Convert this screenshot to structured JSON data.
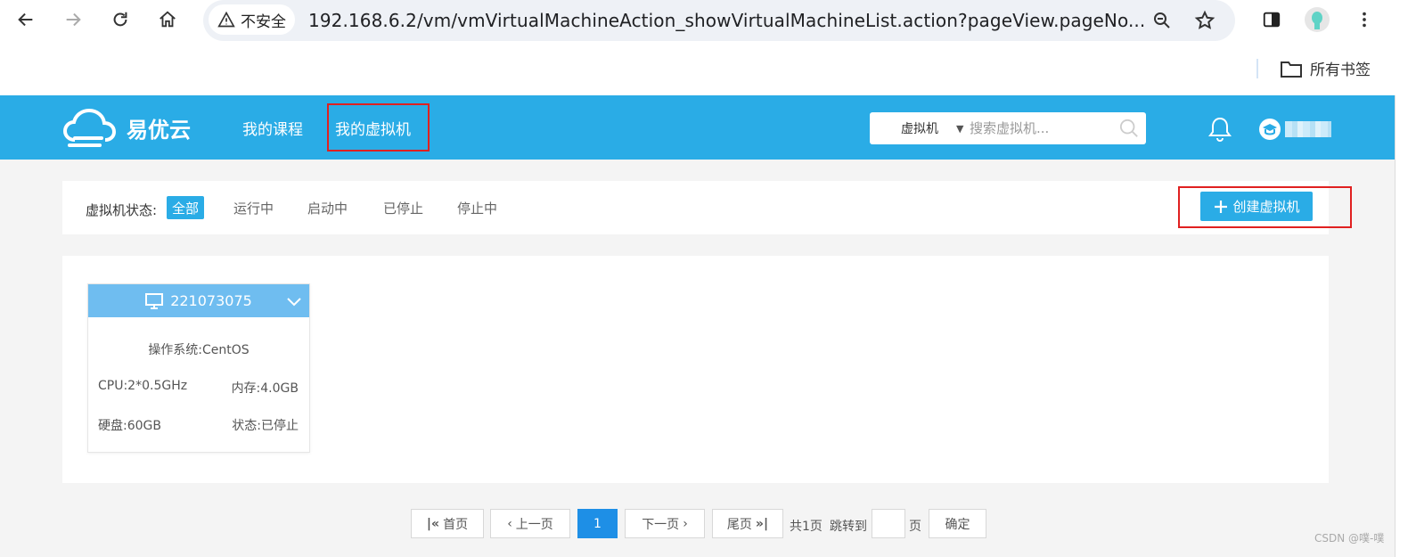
{
  "browser": {
    "security_label": "不安全",
    "url": "192.168.6.2/vm/vmVirtualMachineAction_showVirtualMachineList.action?pageView.pageNo...",
    "bookmark_folder": "所有书签"
  },
  "header": {
    "logo_text": "易优云",
    "nav": [
      {
        "label": "我的课程"
      },
      {
        "label": "我的虚拟机"
      }
    ],
    "search": {
      "type": "虚拟机",
      "placeholder": "搜索虚拟机..."
    }
  },
  "filter": {
    "label": "虚拟机状态:",
    "options": [
      "全部",
      "运行中",
      "启动中",
      "已停止",
      "停止中"
    ],
    "active": "全部",
    "create_button": "创建虚拟机"
  },
  "vm_cards": [
    {
      "name": "221073075",
      "os": "操作系统:CentOS",
      "cpu": "CPU:2*0.5GHz",
      "memory": "内存:4.0GB",
      "disk": "硬盘:60GB",
      "status": "状态:已停止"
    }
  ],
  "pagination": {
    "first": "首页",
    "prev": "上一页",
    "current": "1",
    "next": "下一页",
    "last": "尾页",
    "total": "共1页",
    "jump_label": "跳转到",
    "page_unit": "页",
    "confirm": "确定"
  },
  "watermark": "CSDN @噗-噗",
  "colors": {
    "brand": "#2aace6",
    "card_header": "#6fbdf0",
    "highlight": "#e02020",
    "pager_active": "#1e8fe6"
  }
}
